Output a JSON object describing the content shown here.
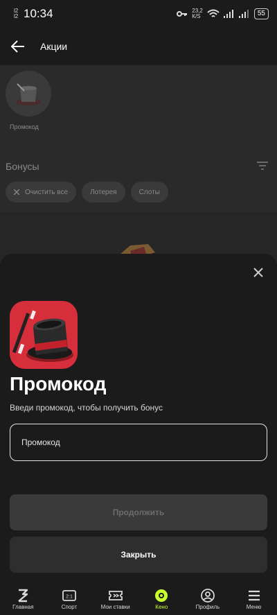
{
  "statusbar": {
    "sim_top": "l2",
    "sim_bottom": "l2",
    "time": "10:34",
    "speed_top": "23,2",
    "speed_bottom": "К/S",
    "battery": "55"
  },
  "header": {
    "title": "Акции"
  },
  "background": {
    "promo_label": "Промокод",
    "bonuses_title": "Бонусы",
    "chips": [
      "Очистить все",
      "Лотерея",
      "Слоты"
    ]
  },
  "sheet": {
    "title": "Промокод",
    "subtitle": "Введи промокод, чтобы получить бонус",
    "input_placeholder": "Промокод",
    "continue_label": "Продолжить",
    "close_label": "Закрыть"
  },
  "nav": {
    "items": [
      {
        "label": "Главная",
        "icon": "home-icon"
      },
      {
        "label": "Спорт",
        "icon": "sport-icon"
      },
      {
        "label": "Мои ставки",
        "icon": "ticket-icon"
      },
      {
        "label": "Кено",
        "icon": "keno-icon"
      },
      {
        "label": "Профиль",
        "icon": "profile-icon"
      },
      {
        "label": "Меню",
        "icon": "menu-icon"
      }
    ],
    "active_color": "#c8ff2e"
  },
  "colors": {
    "accent": "#c8ff2e",
    "app_icon": "#d62e3a"
  }
}
